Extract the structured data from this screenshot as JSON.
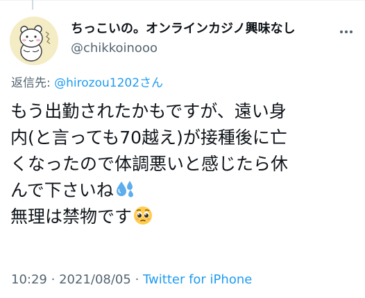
{
  "tweet": {
    "display_name": "ちっこいの。オンラインカジノ興味なし",
    "handle": "@chikkoinooo",
    "more_icon": "more-horizontal-icon",
    "reply_prefix": "返信先:",
    "reply_to": "@hirozou1202さん",
    "body_lines": [
      "もう出勤されたかもですが、遠い身",
      "内(と言っても70越え)が接種後に亡",
      "くなったので体調悪いと感じたら休",
      "んで下さいね",
      "無理は禁物です"
    ],
    "emoji_1": "sweat-droplets-emoji",
    "emoji_2": "pleading-face-emoji",
    "time": "10:29",
    "dot": "·",
    "date": "2021/08/05",
    "source": "Twitter for iPhone"
  },
  "colors": {
    "text": "#0f1419",
    "secondary": "#536471",
    "link": "#1d9bf0",
    "avatar_bg": "#f4ecc4"
  }
}
